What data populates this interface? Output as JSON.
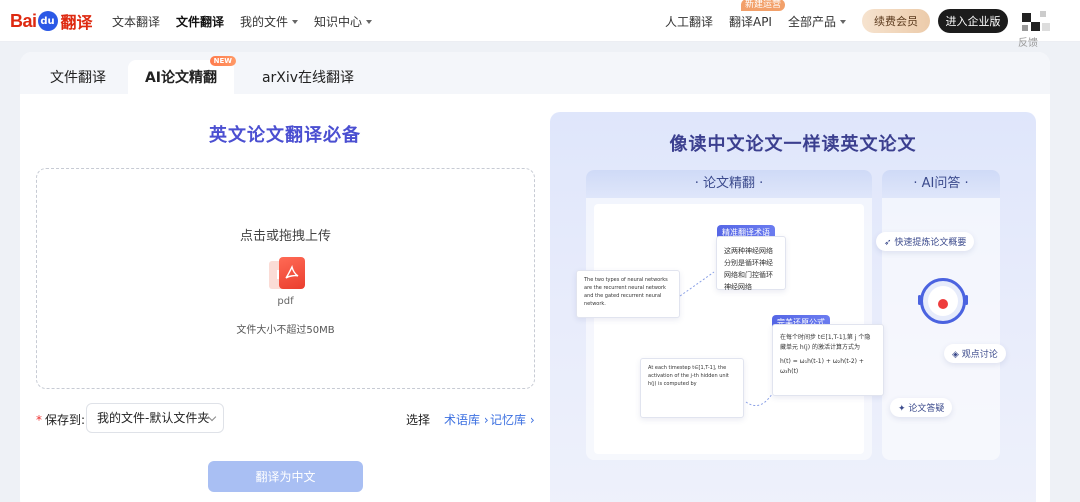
{
  "logo": {
    "bai": "Bai",
    "paw": "du",
    "fanyi": "翻译"
  },
  "nav": {
    "left": [
      {
        "label": "文本翻译",
        "active": false,
        "dropdown": false
      },
      {
        "label": "文件翻译",
        "active": true,
        "dropdown": false
      },
      {
        "label": "我的文件",
        "active": false,
        "dropdown": true
      },
      {
        "label": "知识中心",
        "active": false,
        "dropdown": true
      }
    ],
    "human": "人工翻译",
    "api": "翻译API",
    "api_badge": "新建运营",
    "products": "全部产品",
    "vip": "续费会员",
    "enterprise": "进入企业版",
    "feedback": "反馈"
  },
  "tabs": [
    {
      "label": "文件翻译",
      "active": false
    },
    {
      "label": "AI论文精翻",
      "active": true,
      "badge": "NEW"
    },
    {
      "label": "arXiv在线翻译",
      "active": false
    }
  ],
  "upload": {
    "title": "英文论文翻译必备",
    "prompt": "点击或拖拽上传",
    "file_type": "pdf",
    "back_icon_letter": "F",
    "limit": "文件大小不超过50MB"
  },
  "save": {
    "required_mark": "*",
    "label": "保存到:",
    "value": "我的文件-默认文件夹",
    "select_label": "选择",
    "term_link": "术语库",
    "memory_link": "记忆库"
  },
  "translate_button": "翻译为中文",
  "promo": {
    "title": "像读中文论文一样读英文论文",
    "left_header": "· 论文精翻 ·",
    "right_header": "· AI问答 ·",
    "tag_terms": "精准翻译术语",
    "tag_formula": "完美还原公式",
    "bubble_terms": "这两种神经网络分别是循环神经网络和门控循环神经网络",
    "bubble_en": "The two types of neural networks are the recurrent neural network and the gated recurrent neural network.",
    "bubble_formula": "在每个时间步 t∈[1,T-1],第 j 个隐藏单元 h(j) 的激活计算方式为",
    "bubble_formula_eq": "h(t) = ω₁h(t-1) + ω₂h(t-2) + ω₃h(t)",
    "bubble_formula_en": "At each timestep t∈[1,T-1], the activation of the j-th hidden unit h(j) is computed by",
    "chip_summary": "快速提炼论文概要",
    "chip_discuss": "观点讨论",
    "chip_qa": "论文答疑"
  }
}
